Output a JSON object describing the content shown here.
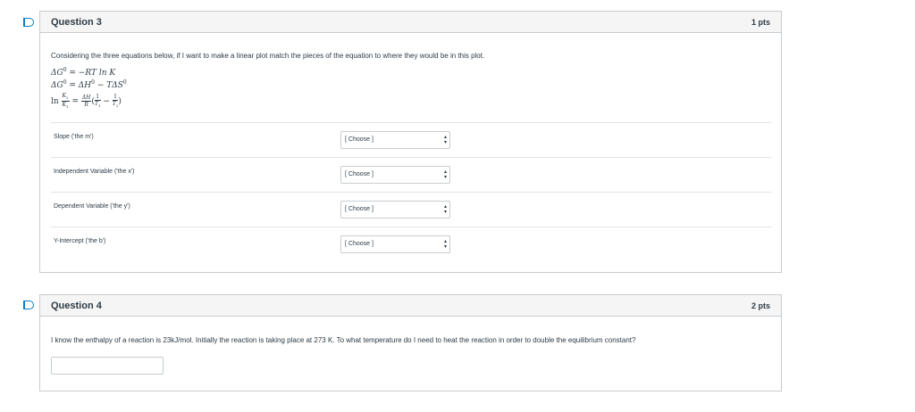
{
  "question3": {
    "title": "Question 3",
    "points": "1 pts",
    "prompt": "Considering the three equations below,  if I want to make a linear plot match the pieces of the equation to where they would be in this plot.",
    "equations": {
      "eq1_lhs": "ΔG",
      "eq1_sup": "0",
      "eq1_rhs": " = −RT ln K",
      "eq2_lhs": "ΔG",
      "eq2_sup": "0",
      "eq2_mid": " = ΔH",
      "eq2_sup2": "0",
      "eq2_rhs": " − TΔS",
      "eq2_sup3": "0",
      "eq3_ln": "ln ",
      "eq3_k2": "K",
      "eq3_k2_sub": "2",
      "eq3_k1": "K",
      "eq3_k1_sub": "1",
      "eq3_eq": " = ",
      "eq3_dh": "ΔH",
      "eq3_r": "R",
      "eq3_open": "(",
      "eq3_one_a": "1",
      "eq3_t1": "T",
      "eq3_t1_sub": "1",
      "eq3_minus": " − ",
      "eq3_one_b": "1",
      "eq3_t2": "T",
      "eq3_t2_sub": "2",
      "eq3_close": ")"
    },
    "rows": [
      {
        "label": "Slope ('the m')",
        "value": "[ Choose ]"
      },
      {
        "label": "Independent Variable ('the x')",
        "value": "[ Choose ]"
      },
      {
        "label": "Dependent Variable ('the y')",
        "value": "[ Choose ]"
      },
      {
        "label": "Y-Intercept ('the b')",
        "value": "[ Choose ]"
      }
    ]
  },
  "question4": {
    "title": "Question 4",
    "points": "2 pts",
    "prompt": "I know the enthalpy of a reaction is 23kJ/mol.  Initially the reaction is taking place at 273 K.  To what temperature do I need to heat the reaction in order to double the equilibrium constant?",
    "answer_value": ""
  },
  "icons": {
    "flag": "flag-icon",
    "select_arrows": "updown-arrow-icon"
  },
  "colors": {
    "accent": "#0e7cc1",
    "border": "#c7cdd1",
    "header_bg": "#f5f5f5",
    "text": "#2d3b45"
  }
}
